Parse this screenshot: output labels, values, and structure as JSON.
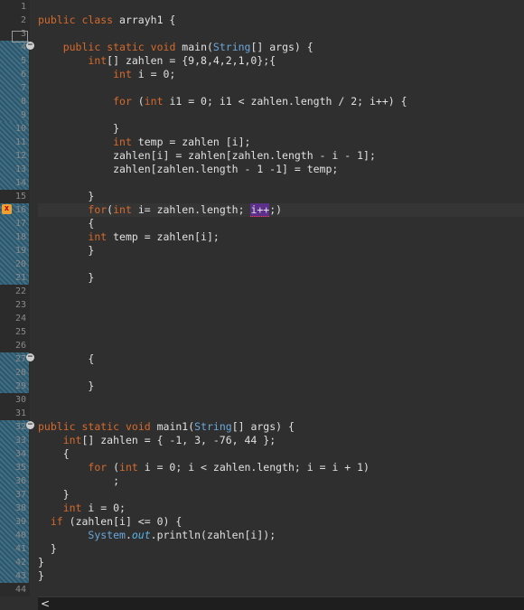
{
  "editor": {
    "line_numbers": [
      "1",
      "2",
      "3",
      "4",
      "5",
      "6",
      "7",
      "8",
      "9",
      "10",
      "11",
      "12",
      "13",
      "14",
      "15",
      "16",
      "17",
      "18",
      "19",
      "20",
      "21",
      "22",
      "23",
      "24",
      "25",
      "26",
      "27",
      "28",
      "29",
      "30",
      "31",
      "32",
      "33",
      "34",
      "35",
      "36",
      "37",
      "38",
      "39",
      "40",
      "41",
      "42",
      "43",
      "44"
    ],
    "lines": {
      "l2": [
        "public",
        " ",
        "class",
        " arrayh1 {"
      ],
      "l4": [
        "    ",
        "public",
        " ",
        "static",
        " ",
        "void",
        " main(",
        "String",
        "[] args) {"
      ],
      "l5": [
        "        ",
        "int",
        "[] zahlen = {9,8,4,2,1,0};{"
      ],
      "l6": [
        "            ",
        "int",
        " i = 0;"
      ],
      "l8": [
        "            ",
        "for",
        " (",
        "int",
        " i1 = 0; i1 < zahlen.length / 2; i++) {"
      ],
      "l10": [
        "            }"
      ],
      "l11": [
        "            ",
        "int",
        " temp = zahlen [i];"
      ],
      "l12": [
        "            zahlen[i] = zahlen[zahlen.length - i - 1];"
      ],
      "l13": [
        "            zahlen[zahlen.length - 1 -1] = temp;"
      ],
      "l15": [
        "        }"
      ],
      "l16": [
        "        ",
        "for",
        "(",
        "int",
        " i= zahlen.length; ",
        "i++",
        ";)"
      ],
      "l17": [
        "        {"
      ],
      "l18": [
        "        ",
        "int",
        " temp = zahlen[i];"
      ],
      "l19": [
        "        }"
      ],
      "l21": [
        "        }"
      ],
      "l27": [
        "        {"
      ],
      "l29": [
        "        }"
      ],
      "l32": [
        "public",
        " ",
        "static",
        " ",
        "void",
        " main1(",
        "String",
        "[] args) {"
      ],
      "l33": [
        "    ",
        "int",
        "[] zahlen = { -1, 3, -76, 44 };"
      ],
      "l34": [
        "    {"
      ],
      "l35": [
        "        ",
        "for",
        " (",
        "int",
        " i = 0; i < zahlen.length; i = i + 1)"
      ],
      "l36": [
        "            ;"
      ],
      "l37": [
        "    }"
      ],
      "l38": [
        "    ",
        "int",
        " i = 0;"
      ],
      "l39": [
        "  ",
        "if",
        " (zahlen[i] <= 0) {"
      ],
      "l40": [
        "        ",
        "System",
        ".",
        "out",
        ".println(zahlen[i]);"
      ],
      "l41": [
        "  }"
      ],
      "l42": [
        "}"
      ],
      "l43": [
        "}"
      ]
    }
  },
  "scrollbar": {
    "left_arrow": "<"
  },
  "colors": {
    "background": "#2f2f2f",
    "keyword": "#d66a2c",
    "type": "#6aa7d9",
    "text": "#e0e0e0",
    "line_number": "#8a8a8a",
    "highlight": "#5b2f8a"
  },
  "icons": [
    "fold-collapse-icon",
    "error-warning-icon",
    "scroll-left-arrow-icon"
  ]
}
